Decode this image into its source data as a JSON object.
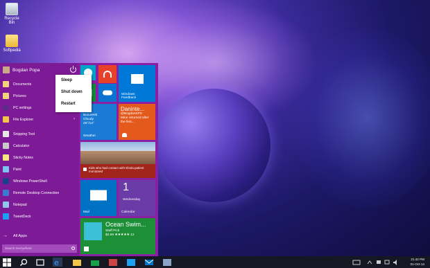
{
  "desktop": {
    "icons": [
      {
        "label": "Recycle Bin"
      },
      {
        "label": "Softpedia"
      }
    ]
  },
  "start_menu": {
    "user_name": "Bogdan Popa",
    "items": [
      {
        "label": "Documents"
      },
      {
        "label": "Pictures"
      },
      {
        "label": "PC settings"
      },
      {
        "label": "File Explorer"
      },
      {
        "label": "Snipping Tool"
      },
      {
        "label": "Calculator"
      },
      {
        "label": "Sticky Notes"
      },
      {
        "label": "Paint"
      },
      {
        "label": "Windows PowerShell"
      },
      {
        "label": "Remote Desktop Connection"
      },
      {
        "label": "Notepad"
      },
      {
        "label": "TweetDeck"
      }
    ],
    "all_apps": "All Apps",
    "search_placeholder": "Search everywhere"
  },
  "power_menu": {
    "sleep": "Sleep",
    "shut_down": "Shut down",
    "restart": "Restart"
  },
  "tiles": {
    "feedback": "Windows Feedback",
    "weather": {
      "line1": "Bucuresti",
      "line2": "Cloudy",
      "line3": "25°/14°",
      "label": "Weather"
    },
    "twitter": {
      "name": "Daninte...",
      "handle": "@BogdanSFD",
      "text": "Mine returned after the first..."
    },
    "news": "Kids who had contact with Ebola patient monitored",
    "mail": "Mail",
    "calendar": {
      "day": "1",
      "weekday": "Wednesday",
      "label": "Calendar"
    },
    "store": {
      "title": "Ocean Swim...",
      "subtitle": "Staff Pick",
      "price": "$2.99 ★★★★★ 12"
    }
  },
  "taskbar": {
    "time": "21:42 PM",
    "date": "01-Oct-14"
  }
}
